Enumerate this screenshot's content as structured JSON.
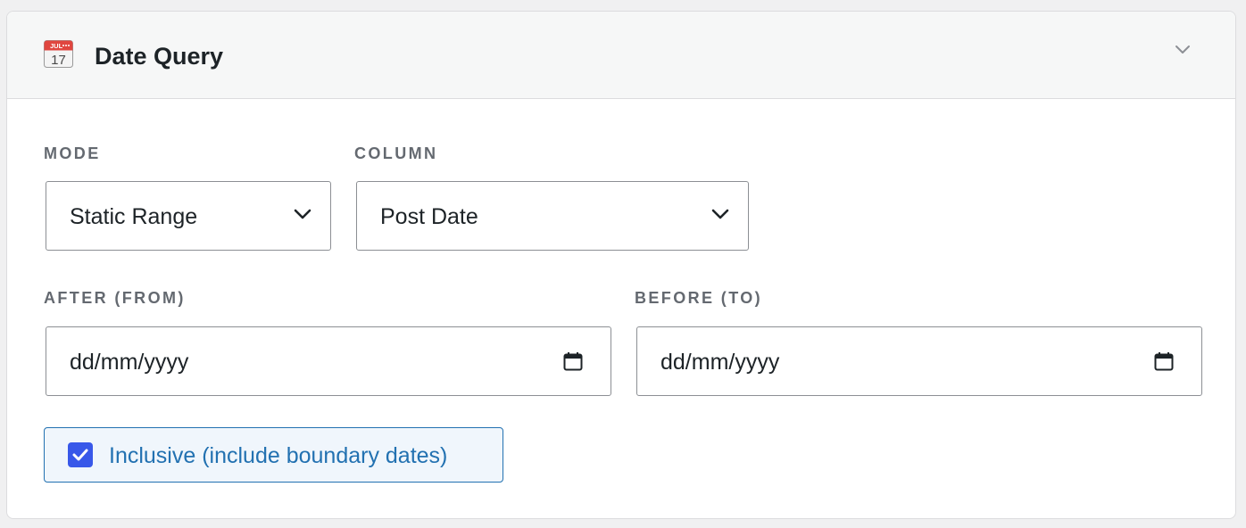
{
  "header": {
    "icon": "calendar-icon",
    "calendar_month": "JUL",
    "calendar_day": "17",
    "title": "Date Query",
    "collapse_icon": "chevron-down-icon"
  },
  "fields": {
    "mode": {
      "label": "MODE",
      "value": "Static Range"
    },
    "column": {
      "label": "COLUMN",
      "value": "Post Date"
    },
    "after": {
      "label": "AFTER (FROM)",
      "placeholder": "dd/mm/yyyy"
    },
    "before": {
      "label": "BEFORE (TO)",
      "placeholder": "dd/mm/yyyy"
    }
  },
  "inclusive": {
    "checked": true,
    "label": "Inclusive (include boundary dates)"
  },
  "colors": {
    "accent": "#2271b1",
    "checkbox": "#3858e9",
    "label_gray": "#646970",
    "border": "#8c8f94"
  }
}
